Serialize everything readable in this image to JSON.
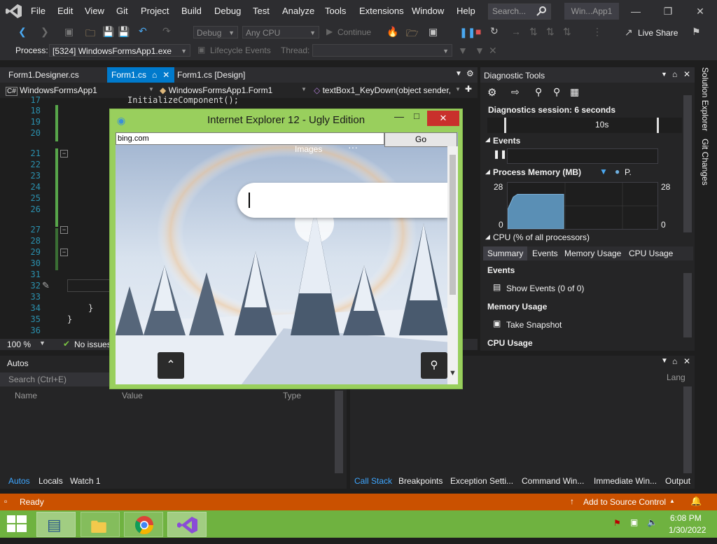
{
  "menubar": {
    "items": [
      "File",
      "Edit",
      "View",
      "Git",
      "Project",
      "Build",
      "Debug",
      "Test",
      "Analyze",
      "Tools",
      "Extensions",
      "Window",
      "Help"
    ],
    "search_placeholder": "Search...",
    "window_title": "Win...App1"
  },
  "toolbar": {
    "config": "Debug",
    "platform": "Any CPU",
    "continue_label": "Continue",
    "live_share": "Live Share",
    "process_label": "Process:",
    "process_value": "[5324] WindowsFormsApp1.exe",
    "lifecycle_label": "Lifecycle Events",
    "thread_label": "Thread:"
  },
  "editor_tabs": [
    {
      "label": "Form1.Designer.cs"
    },
    {
      "label": "Form1.cs"
    },
    {
      "label": "Form1.cs [Design]"
    }
  ],
  "nav": {
    "project": "WindowsFormsApp1",
    "class": "WindowsFormsApp1.Form1",
    "member": "textBox1_KeyDown(object sender,"
  },
  "editor": {
    "line_numbers": [
      "17",
      "18",
      "19",
      "20",
      "21",
      "22",
      "23",
      "24",
      "25",
      "26",
      "27",
      "28",
      "29",
      "30",
      "31",
      "32",
      "33",
      "34",
      "35",
      "36"
    ],
    "visible_code": "InitializeComponent();",
    "brace_close": "}",
    "zoom": "100 %",
    "issues": "No issues"
  },
  "ie_window": {
    "title": "Internet Explorer 12 - Ugly Edition",
    "address": "bing.com",
    "go_label": "Go",
    "images_label": "Images",
    "more_label": "···"
  },
  "diagnostics": {
    "title": "Diagnostic Tools",
    "session": "Diagnostics session: 6 seconds",
    "timeline_label": "10s",
    "events_label": "Events",
    "process_memory_label": "Process Memory (MB)",
    "memory_legend": "P.",
    "mem_max": "28",
    "mem_min": "0",
    "cpu_label": "CPU (% of all processors)",
    "tabs": [
      "Summary",
      "Events",
      "Memory Usage",
      "CPU Usage"
    ],
    "events_section": "Events",
    "show_events": "Show Events (0 of 0)",
    "memory_section": "Memory Usage",
    "take_snapshot": "Take Snapshot",
    "cpu_section": "CPU Usage",
    "memory_chart_fraction": 0.75
  },
  "side_tabs": [
    "Solution Explorer",
    "Git Changes"
  ],
  "autos": {
    "title": "Autos",
    "search_placeholder": "Search (Ctrl+E)",
    "columns": [
      "Name",
      "Value",
      "Type"
    ],
    "tabs": [
      "Autos",
      "Locals",
      "Watch 1"
    ]
  },
  "callstack": {
    "lang_col": "Lang",
    "tabs": [
      "Call Stack",
      "Breakpoints",
      "Exception Setti...",
      "Command Win...",
      "Immediate Win...",
      "Output"
    ]
  },
  "statusbar": {
    "ready": "Ready",
    "source_control": "Add to Source Control"
  },
  "taskbar": {
    "time": "6:08 PM",
    "date": "1/30/2022"
  },
  "colors": {
    "accent": "#007acc",
    "statusbar": "#ca5100",
    "taskbar": "#6fb240",
    "ie_frame": "#99cf5d"
  }
}
